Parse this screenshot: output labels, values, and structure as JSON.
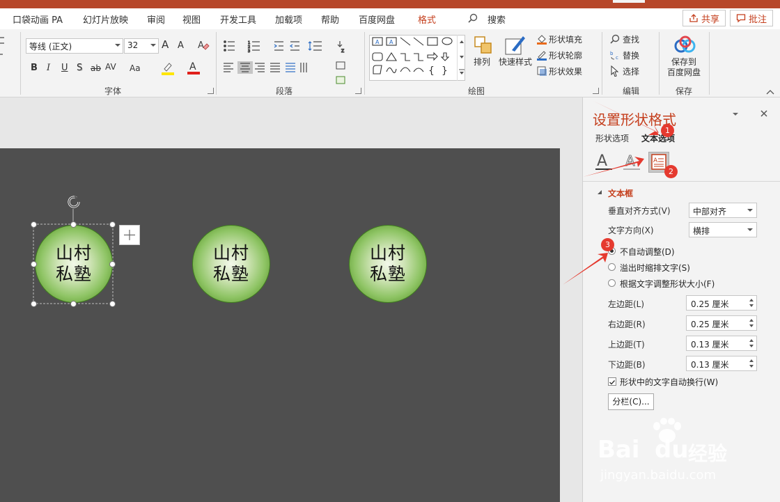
{
  "colors": {
    "accent": "#c43e1c",
    "titlebar": "#b7472a",
    "slide_bg": "#4f4f4f",
    "shape_fill": "#8ec464",
    "annotation": "#e53a2f"
  },
  "tabs": [
    "口袋动画 PA",
    "幻灯片放映",
    "审阅",
    "视图",
    "开发工具",
    "加载项",
    "帮助",
    "百度网盘",
    "格式"
  ],
  "tab_search": "搜索",
  "top_buttons": {
    "share": "共享",
    "comment": "批注"
  },
  "ribbon": {
    "font": {
      "name": "等线 (正文)",
      "size": "32",
      "grow_label": "A",
      "shrink_label": "A",
      "bold": "B",
      "italic": "I",
      "underline": "U",
      "shadow": "S",
      "strike": "ab",
      "spacing": "AV",
      "case": "Aa",
      "group_label": "字体"
    },
    "paragraph": {
      "group_label": "段落"
    },
    "drawing": {
      "arrange": "排列",
      "quick_styles": "快速样式",
      "shape_fill": "形状填充",
      "shape_outline": "形状轮廓",
      "shape_effects": "形状效果",
      "group_label": "绘图"
    },
    "editing": {
      "find": "查找",
      "replace": "替换",
      "select": "选择",
      "group_label": "编辑"
    },
    "save": {
      "line1": "保存到",
      "line2": "百度网盘",
      "group_label": "保存"
    }
  },
  "slide": {
    "shapes": [
      {
        "line1": "山村",
        "line2": "私塾"
      },
      {
        "line1": "山村",
        "line2": "私塾"
      },
      {
        "line1": "山村",
        "line2": "私塾"
      }
    ]
  },
  "pane": {
    "title": "设置形状格式",
    "tab_shape": "形状选项",
    "tab_text": "文本选项",
    "section": "文本框",
    "valign_label": "垂直对齐方式(V)",
    "valign_value": "中部对齐",
    "direction_label": "文字方向(X)",
    "direction_value": "横排",
    "radio_no_autofit": "不自动调整(D)",
    "radio_shrink": "溢出时缩排文字(S)",
    "radio_resize": "根据文字调整形状大小(F)",
    "left_margin_label": "左边距(L)",
    "left_margin": "0.25 厘米",
    "right_margin_label": "右边距(R)",
    "right_margin": "0.25 厘米",
    "top_margin_label": "上边距(T)",
    "top_margin": "0.13 厘米",
    "bottom_margin_label": "下边距(B)",
    "bottom_margin": "0.13 厘米",
    "wrap_label": "形状中的文字自动换行(W)",
    "columns_button": "分栏(C)..."
  },
  "annotations": [
    "1",
    "2",
    "3"
  ],
  "watermark": {
    "brand": "Bai",
    "brand2": "du",
    "cn": "经验",
    "url": "jingyan.baidu.com"
  }
}
